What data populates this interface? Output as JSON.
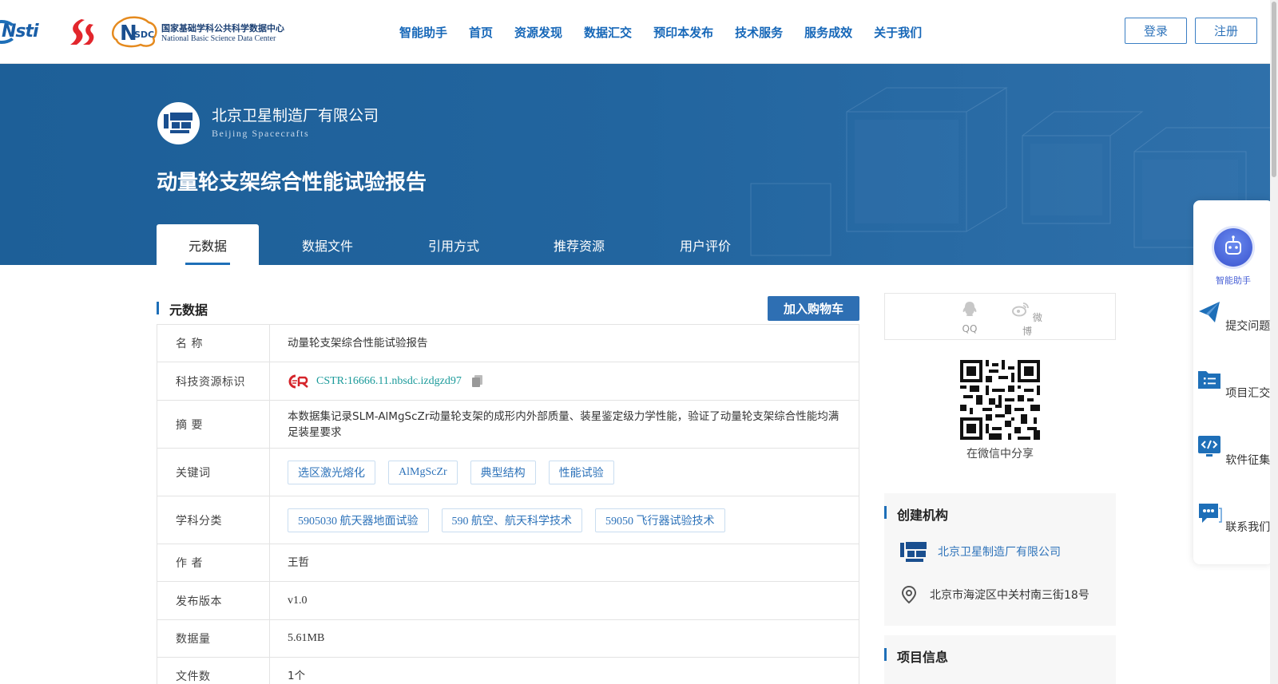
{
  "header": {
    "logo_cstin_text": "Nsti",
    "nsdc_cn": "国家基础学科公共科学数据中心",
    "nsdc_en": "National Basic Science Data Center",
    "nav": [
      "智能助手",
      "首页",
      "资源发现",
      "数据汇交",
      "预印本发布",
      "技术服务",
      "服务成效",
      "关于我们"
    ],
    "login": "登录",
    "register": "注册"
  },
  "banner": {
    "org_cn": "北京卫星制造厂有限公司",
    "org_en": "Beijing Spacecrafts",
    "title": "动量轮支架综合性能试验报告",
    "tabs": [
      "元数据",
      "数据文件",
      "引用方式",
      "推荐资源",
      "用户评价"
    ]
  },
  "metadata": {
    "section_title": "元数据",
    "cart_button": "加入购物车",
    "rows": {
      "name": {
        "label": "名 称",
        "value": "动量轮支架综合性能试验报告"
      },
      "cstr": {
        "label": "科技资源标识",
        "value": "CSTR:16666.11.nbsdc.izdgzd97"
      },
      "abstract": {
        "label": "摘 要",
        "value": "本数据集记录SLM-AlMgScZr动量轮支架的成形内外部质量、装星鉴定级力学性能，验证了动量轮支架综合性能均满足装星要求"
      },
      "keywords": {
        "label": "关键词",
        "tags": [
          "选区激光熔化",
          "AlMgScZr",
          "典型结构",
          "性能试验"
        ]
      },
      "subjects": {
        "label": "学科分类",
        "tags": [
          "5905030 航天器地面试验",
          "590 航空、航天科学技术",
          "59050 飞行器试验技术"
        ]
      },
      "author": {
        "label": "作 者",
        "value": "王哲"
      },
      "version": {
        "label": "发布版本",
        "value": "v1.0"
      },
      "size": {
        "label": "数据量",
        "value": "5.61MB"
      },
      "files": {
        "label": "文件数",
        "value": "1个"
      }
    }
  },
  "share": {
    "qq": "QQ",
    "weibo": "微博",
    "wechat_caption": "在微信中分享"
  },
  "creator": {
    "title": "创建机构",
    "name": "北京卫星制造厂有限公司",
    "address": "北京市海淀区中关村南三街18号"
  },
  "project": {
    "title": "项目信息"
  },
  "float_bar": {
    "assistant": "智能助手",
    "submit": "提交问题",
    "project": "项目汇交",
    "software": "软件征集",
    "contact": "联系我们"
  },
  "colors": {
    "brand_blue": "#1e6fb8",
    "banner_blue": "#22659f",
    "tag_text": "#2e73ba",
    "cstr_teal": "#1a9a9a"
  }
}
